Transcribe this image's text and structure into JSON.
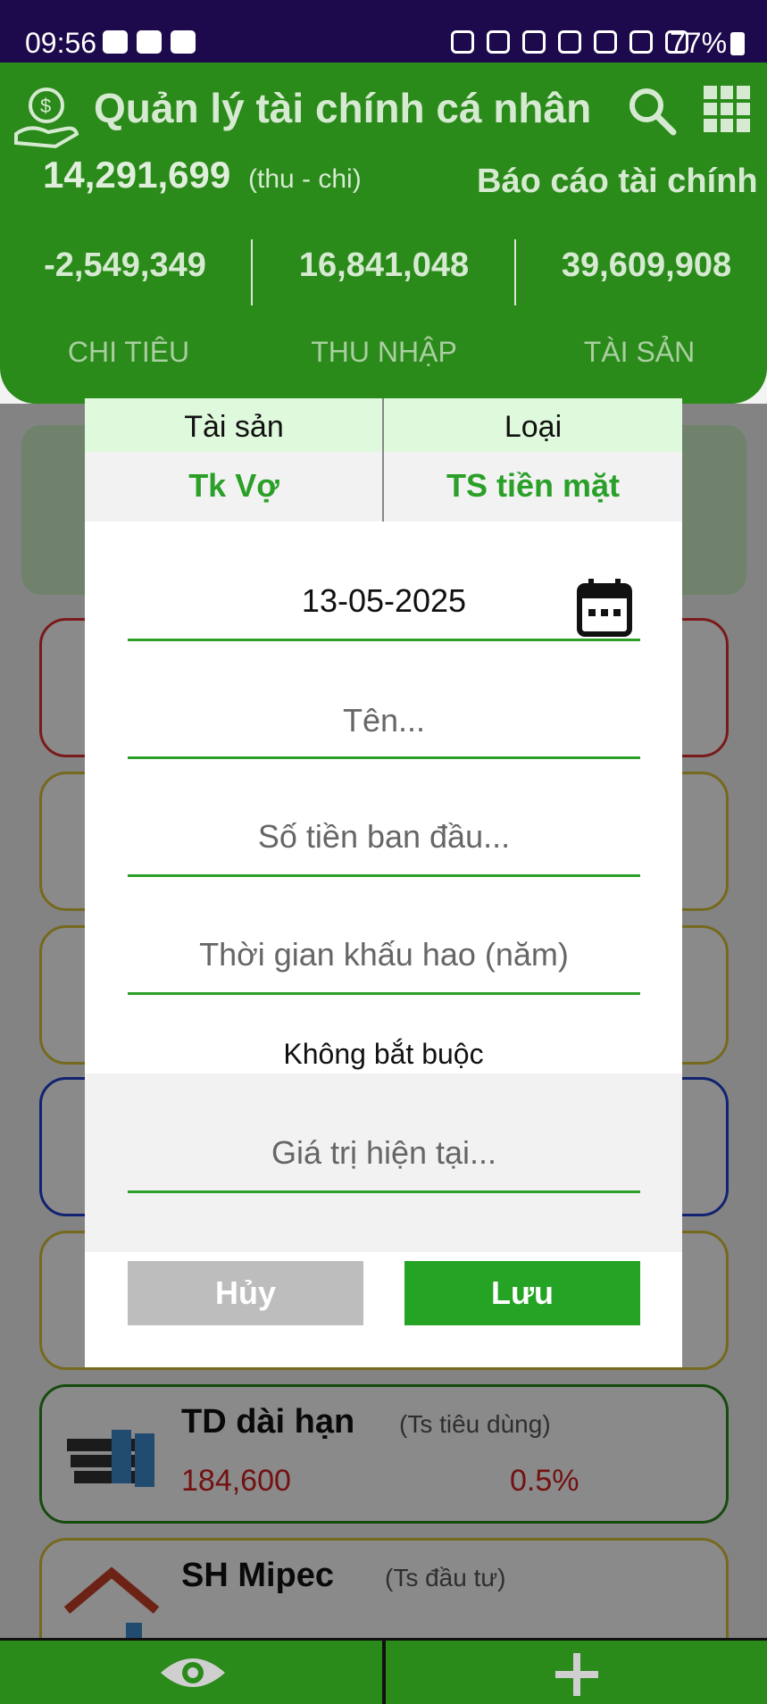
{
  "status_bar": {
    "time": "09:56",
    "battery": "77%"
  },
  "header": {
    "title": "Quản lý tài chính cá nhân",
    "net_value": "14,291,699",
    "net_note": "(thu - chi)",
    "report_link": "Báo cáo tài chính >",
    "stats": [
      "-2,549,349",
      "16,841,048",
      "39,609,908"
    ],
    "tabs": [
      "CHI TIÊU",
      "THU NHẬP",
      "TÀI SẢN"
    ]
  },
  "background_list": [
    {
      "name": "TD dài hạn",
      "kind": "(Ts tiêu dùng)",
      "value": "184,600",
      "percent": "0.5%",
      "border": "#2a8a1a"
    },
    {
      "name": "SH Mipec",
      "kind": "(Ts đầu tư)",
      "value": "",
      "percent": "",
      "border": "#d8c238"
    }
  ],
  "dialog": {
    "asset_label": "Tài sản",
    "type_label": "Loại",
    "asset_value": "Tk Vợ",
    "type_value": "TS tiền mặt",
    "date": "13-05-2025",
    "name_placeholder": "Tên...",
    "initial_amount_placeholder": "Số tiền ban đầu...",
    "depreciation_placeholder": "Thời gian khấu hao (năm)",
    "optional_label": "Không bắt buộc",
    "current_value_placeholder": "Giá trị hiện tại...",
    "cancel_label": "Hủy",
    "save_label": "Lưu"
  },
  "colors": {
    "brand_green": "#2a8a1a",
    "accent_green": "#25a325",
    "negative_red": "#d42020"
  },
  "icons": {
    "header": [
      "money-hand-icon",
      "search-icon",
      "grid-menu-icon"
    ],
    "dialog": [
      "calendar-icon"
    ],
    "bottom": [
      "eye-icon",
      "plus-icon"
    ]
  }
}
